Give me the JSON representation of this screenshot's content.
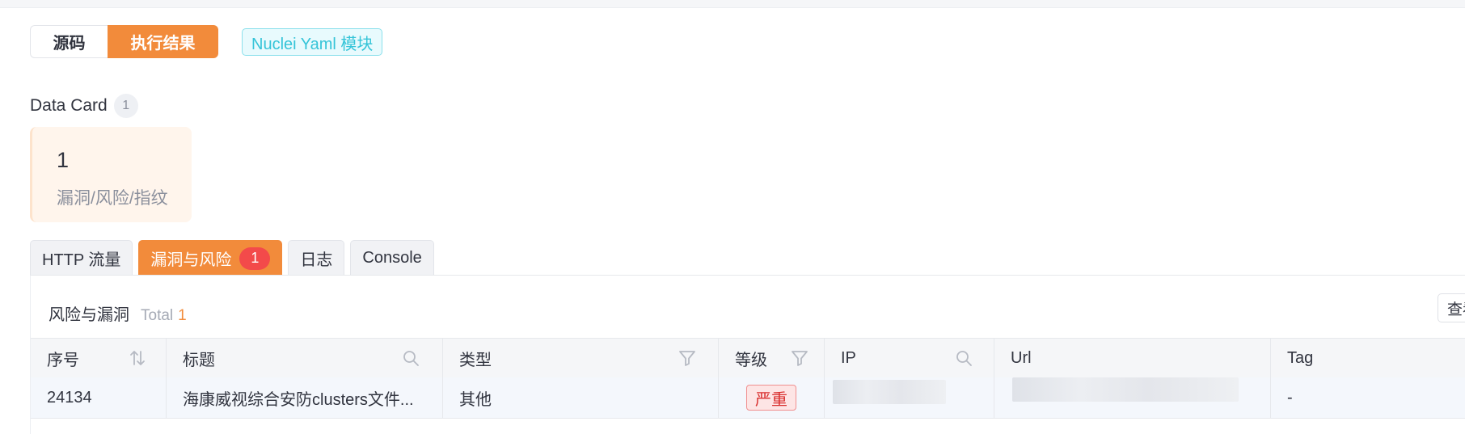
{
  "toggle": {
    "source_label": "源码",
    "result_label": "执行结果"
  },
  "module_tag": "Nuclei Yaml 模块",
  "data_card": {
    "title": "Data Card",
    "count": "1",
    "cards": [
      {
        "value": "1",
        "label": "漏洞/风险/指纹"
      }
    ]
  },
  "tabs": [
    {
      "label": "HTTP 流量"
    },
    {
      "label": "漏洞与风险",
      "badge": "1",
      "active": true
    },
    {
      "label": "日志"
    },
    {
      "label": "Console"
    }
  ],
  "table": {
    "title": "风险与漏洞",
    "total_label": "Total",
    "total_value": "1",
    "more_button": "查看",
    "columns": [
      {
        "label": "序号",
        "icon": "sort-icon"
      },
      {
        "label": "标题",
        "icon": "search-icon"
      },
      {
        "label": "类型",
        "icon": "filter-icon"
      },
      {
        "label": "等级",
        "icon": "filter-icon"
      },
      {
        "label": "IP",
        "icon": "search-icon"
      },
      {
        "label": "Url"
      },
      {
        "label": "Tag"
      }
    ],
    "rows": [
      {
        "id": "24134",
        "title": "海康威视综合安防clusters文件...",
        "type": "其他",
        "level": "严重",
        "ip": "",
        "url": "",
        "tag": "-"
      }
    ]
  },
  "colors": {
    "accent": "#f28b3b",
    "danger": "#f34a4a",
    "info": "#35c4d8"
  }
}
